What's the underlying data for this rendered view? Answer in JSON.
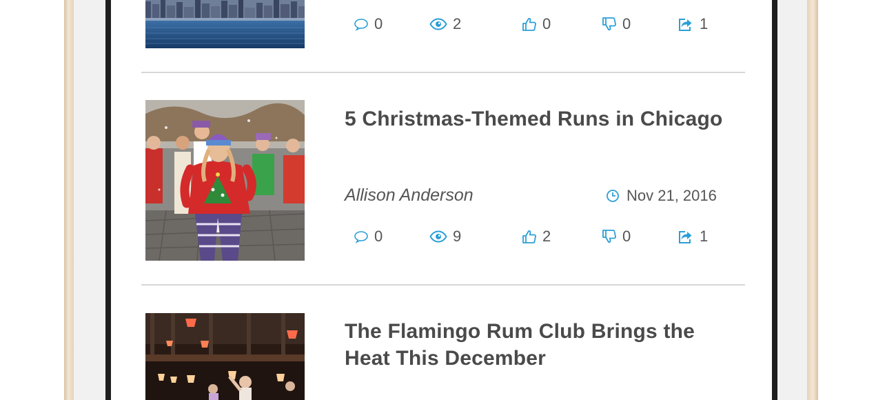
{
  "colors": {
    "accent": "#2a9fd6",
    "text": "#4a4a4a",
    "divider": "#d6d6d6"
  },
  "articles": [
    {
      "title": "",
      "stats": {
        "comments": "0",
        "views": "2",
        "likes": "0",
        "dislikes": "0",
        "shares": "1"
      }
    },
    {
      "title": "5 Christmas-Themed Runs in Chicago",
      "author": "Allison Anderson",
      "date": "Nov 21, 2016",
      "stats": {
        "comments": "0",
        "views": "9",
        "likes": "2",
        "dislikes": "0",
        "shares": "1"
      }
    },
    {
      "title": "The Flamingo Rum Club Brings the Heat This December"
    }
  ],
  "icons": [
    "comment-icon",
    "eye-icon",
    "thumbs-up-icon",
    "thumbs-down-icon",
    "share-icon",
    "clock-icon"
  ]
}
